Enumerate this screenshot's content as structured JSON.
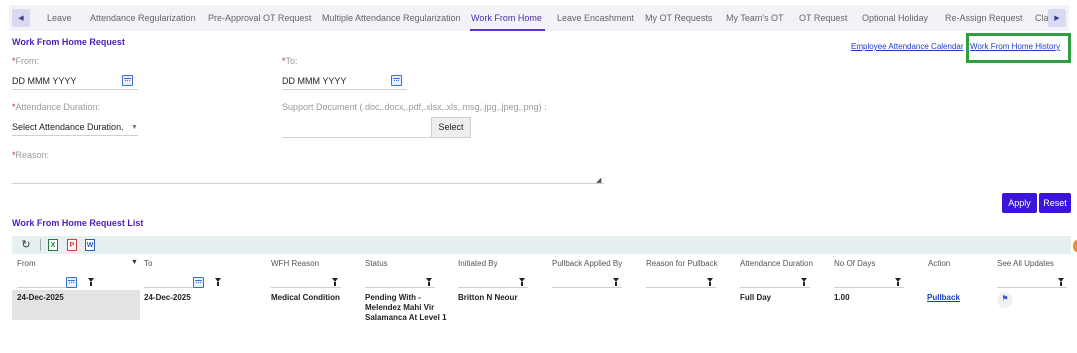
{
  "tabs": [
    {
      "label": "Leave",
      "active": false
    },
    {
      "label": "Attendance Regularization",
      "active": false
    },
    {
      "label": "Pre-Approval OT Request",
      "active": false
    },
    {
      "label": "Multiple Attendance Regularization",
      "active": false
    },
    {
      "label": "Work From Home",
      "active": true
    },
    {
      "label": "Leave Encashment",
      "active": false
    },
    {
      "label": "My OT Requests",
      "active": false
    },
    {
      "label": "My Team's OT",
      "active": false
    },
    {
      "label": "OT Request",
      "active": false
    },
    {
      "label": "Optional Holiday",
      "active": false
    },
    {
      "label": "Re-Assign Request",
      "active": false
    },
    {
      "label": "Cla",
      "active": false
    }
  ],
  "form": {
    "title": "Work From Home Request",
    "required_mark": "*",
    "from_label": "From:",
    "from_value": "DD MMM YYYY",
    "to_label": "To:",
    "to_value": "DD MMM YYYY",
    "attendance_duration_label": "Attendance Duration:",
    "attendance_duration_value": "Select Attendance Duration.",
    "support_doc_label": "Support Document (.doc,.docx,.pdf,.xlsx,.xls,.msg,.jpg,.jpeg,.png) :",
    "select_button": "Select",
    "reason_label": "Reason:",
    "reason_value": ""
  },
  "links": {
    "calendar": "Employee Attendance Calendar",
    "history": "Work From Home History"
  },
  "actions": {
    "apply": "Apply",
    "reset": "Reset"
  },
  "list": {
    "title": "Work From Home Request List",
    "toolbar_icons": [
      "refresh-icon",
      "excel-icon",
      "pdf-icon",
      "word-icon"
    ],
    "columns": [
      "From",
      "To",
      "WFH Reason",
      "Status",
      "Initiated By",
      "Pullback Applied By",
      "Reason for Pullback",
      "Attendance Duration",
      "No Of Days",
      "Action",
      "See All Updates"
    ],
    "rows": [
      {
        "from": "24-Dec-2025",
        "to": "24-Dec-2025",
        "reason": "Medical Condition",
        "status": "Pending With -Melendez Mahi Vir Salamanca At Level 1",
        "initiated_by": "Britton N Neour",
        "pullback_applied_by": "",
        "pullback_reason": "",
        "attendance_duration": "Full Day",
        "days": "1.00",
        "action": "Pullback"
      }
    ]
  },
  "colors": {
    "accent": "#3b14d8",
    "title": "#4b1fbd",
    "link": "#1a3fc7",
    "highlight": "#2e9e3e",
    "required": "#d0262d"
  }
}
